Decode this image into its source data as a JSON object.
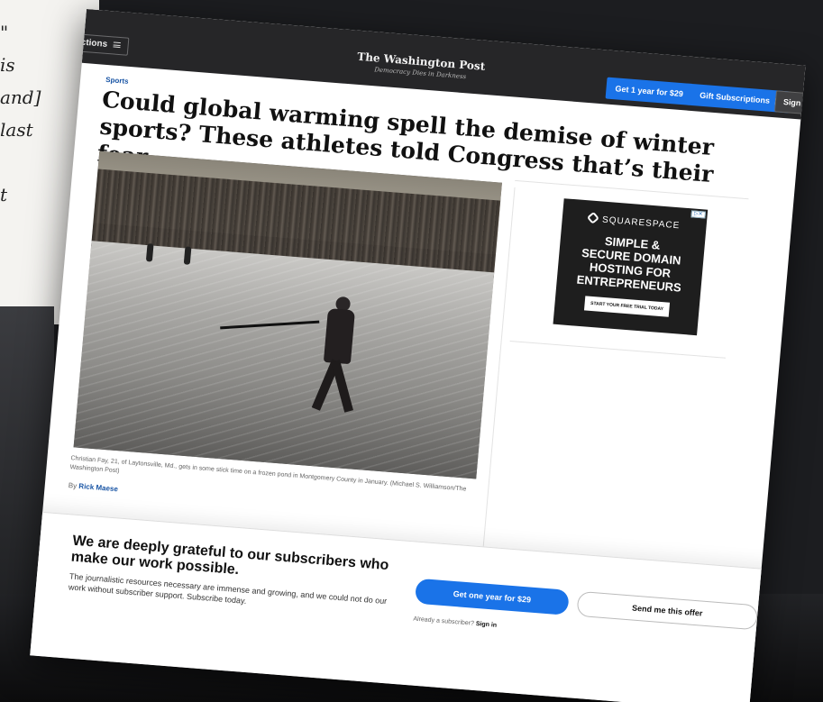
{
  "background": {
    "quote_text": "\"\nis\nand]\nlast\n\nt"
  },
  "topbar": {
    "sections_label": "ctions",
    "logo": "The Washington Post",
    "tagline": "Democracy Dies in Darkness",
    "subscribe_label": "Get 1 year for $29",
    "gift_label": "Gift Subscriptions",
    "signin_label": "Sign in"
  },
  "article": {
    "kicker": "Sports",
    "headline": "Could global warming spell the demise of winter sports? These athletes told Congress that’s their fear.",
    "caption": "Christian Fay, 21, of Laytonsville, Md., gets in some stick time on a frozen pond in Montgomery County in January. (Michael S. Williamson/The Washington Post)",
    "byline_prefix": "By",
    "author": "Rick Maese"
  },
  "ad": {
    "brand": "SQUARESPACE",
    "copy": "SIMPLE &\nSECURE DOMAIN\nHOSTING FOR\nENTREPRENEURS",
    "cta": "START YOUR FREE TRIAL TODAY",
    "choices": "▷✕"
  },
  "paywall": {
    "heading": "We are deeply grateful to our subscribers who make our work possible.",
    "body": "The journalistic resources necessary are immense and growing, and we could not do our work without subscriber support. Subscribe today.",
    "primary_label": "Get one year for $29",
    "already_text": "Already a subscriber?",
    "signin_link": "Sign in",
    "secondary_label": "Send me this offer"
  },
  "colors": {
    "accent_blue": "#1a73e8",
    "link_blue": "#1955a5",
    "topbar": "#262628"
  }
}
